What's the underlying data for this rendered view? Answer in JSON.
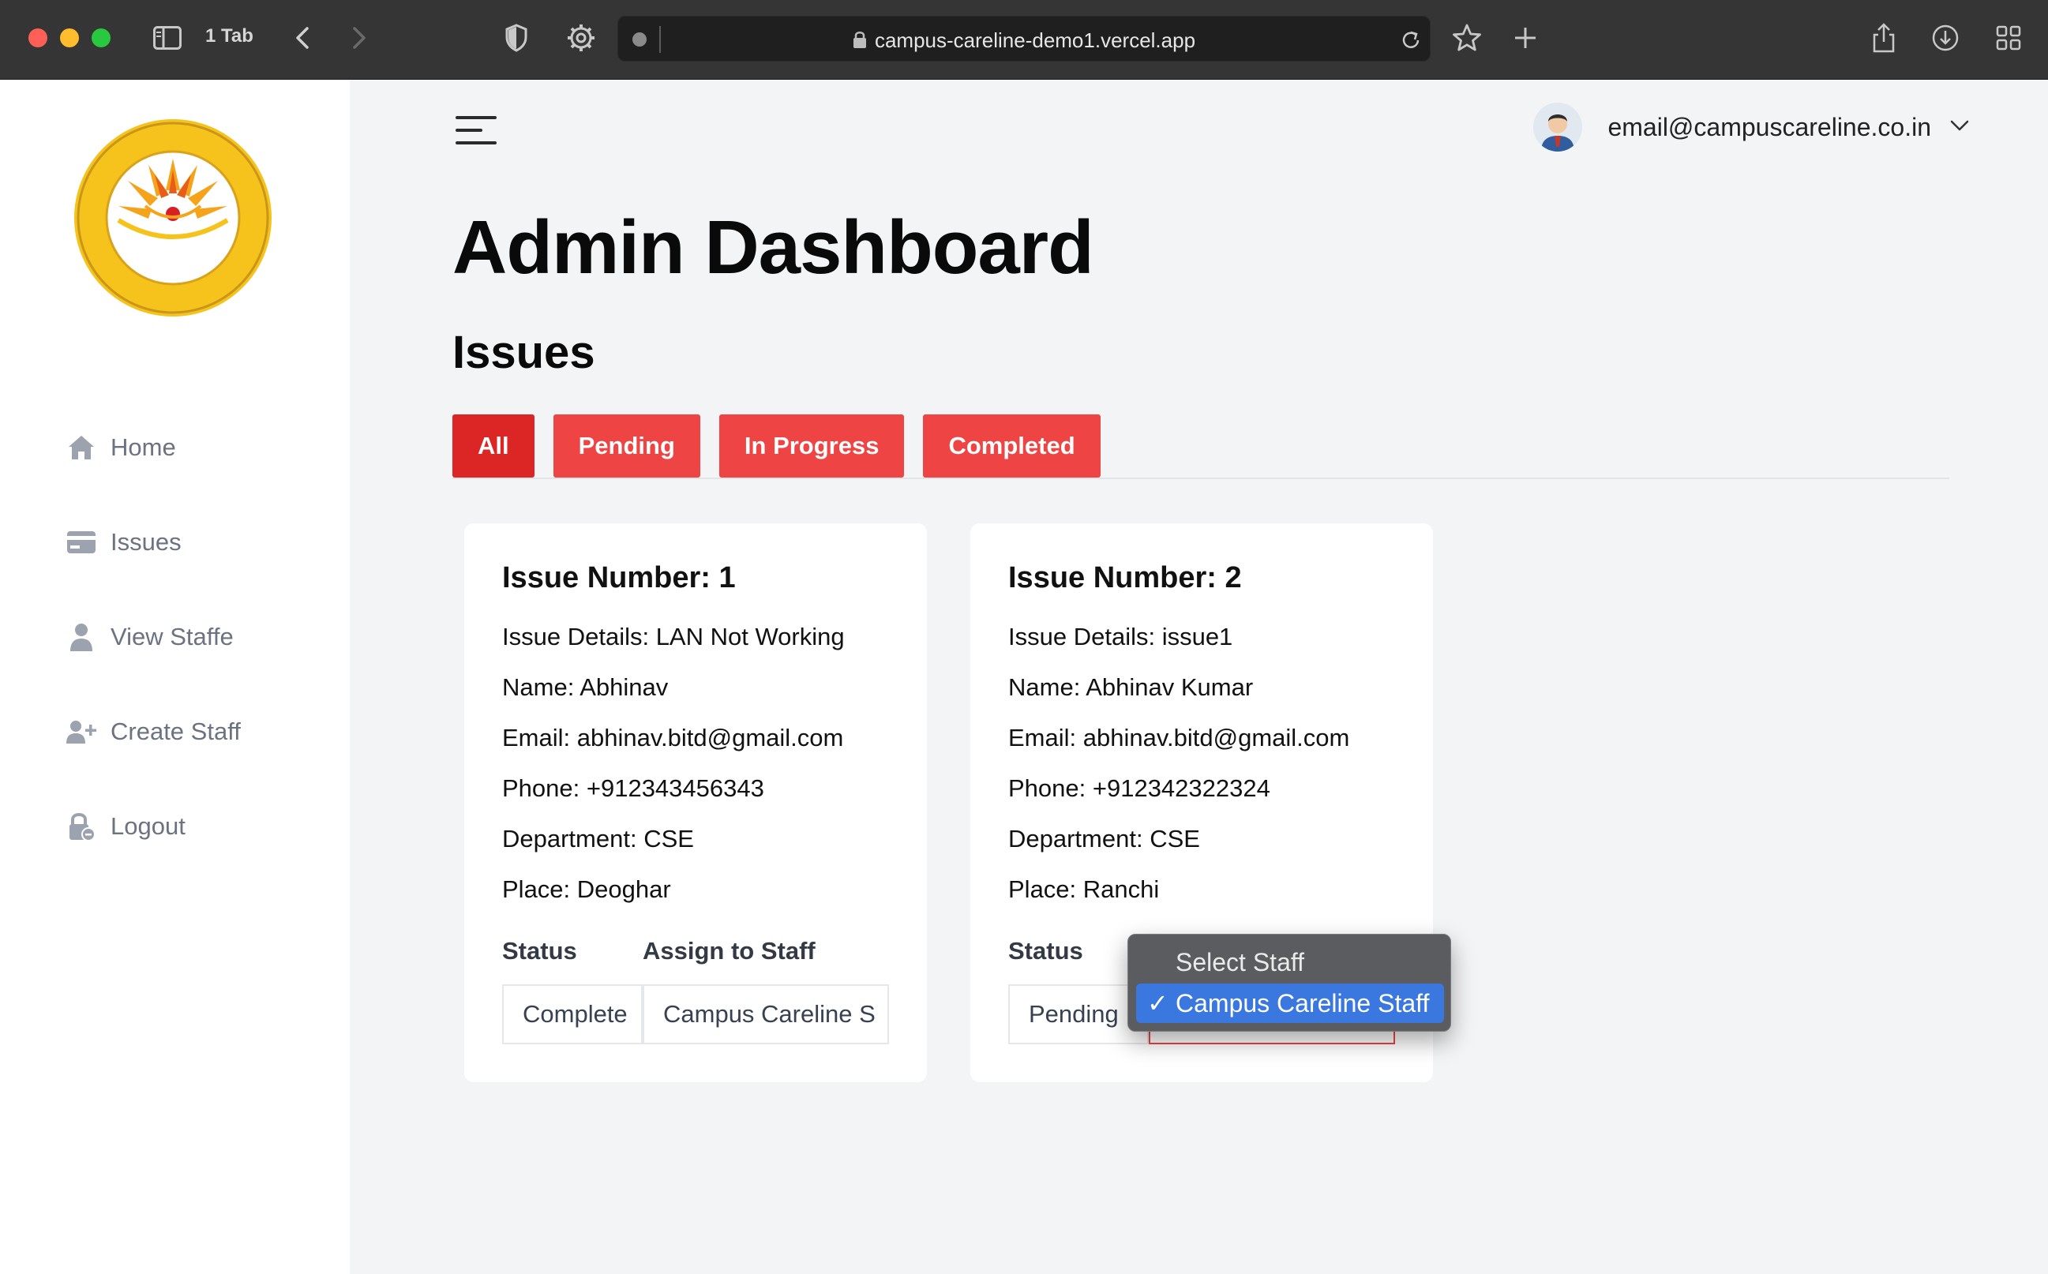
{
  "browser": {
    "tab_count_label": "1 Tab",
    "url": "campus-careline-demo1.vercel.app"
  },
  "sidebar": {
    "items": [
      {
        "label": "Home",
        "icon": "home-icon"
      },
      {
        "label": "Issues",
        "icon": "card-icon"
      },
      {
        "label": "View Staffe",
        "icon": "user-icon"
      },
      {
        "label": "Create Staff",
        "icon": "user-plus-icon"
      },
      {
        "label": "Logout",
        "icon": "lock-icon"
      }
    ]
  },
  "header": {
    "user_email": "email@campuscareline.co.in"
  },
  "page": {
    "title": "Admin Dashboard",
    "section_title": "Issues"
  },
  "filters": {
    "all": "All",
    "pending": "Pending",
    "in_progress": "In Progress",
    "completed": "Completed",
    "active": "All"
  },
  "issues": [
    {
      "title": "Issue Number: 1",
      "details": "Issue Details: LAN Not Working",
      "name": "Name: Abhinav",
      "email": "Email: abhinav.bitd@gmail.com",
      "phone": "Phone: +912343456343",
      "department": "Department: CSE",
      "place": "Place: Deoghar",
      "status_label": "Status",
      "assign_label": "Assign to Staff",
      "status_value": "Complete",
      "assign_value": "Campus Careline S"
    },
    {
      "title": "Issue Number: 2",
      "details": "Issue Details: issue1",
      "name": "Name: Abhinav Kumar",
      "email": "Email: abhinav.bitd@gmail.com",
      "phone": "Phone: +912342322324",
      "department": "Department: CSE",
      "place": "Place: Ranchi",
      "status_label": "Status",
      "status_value": "Pending"
    }
  ],
  "staff_dropdown": {
    "options": [
      "Select Staff",
      "Campus Careline Staff"
    ],
    "selected": "Campus Careline Staff"
  },
  "colors": {
    "accent": "#ef4444",
    "accent_active": "#dc2626",
    "sidebar_text": "#6b7280",
    "background": "#f3f4f6"
  }
}
